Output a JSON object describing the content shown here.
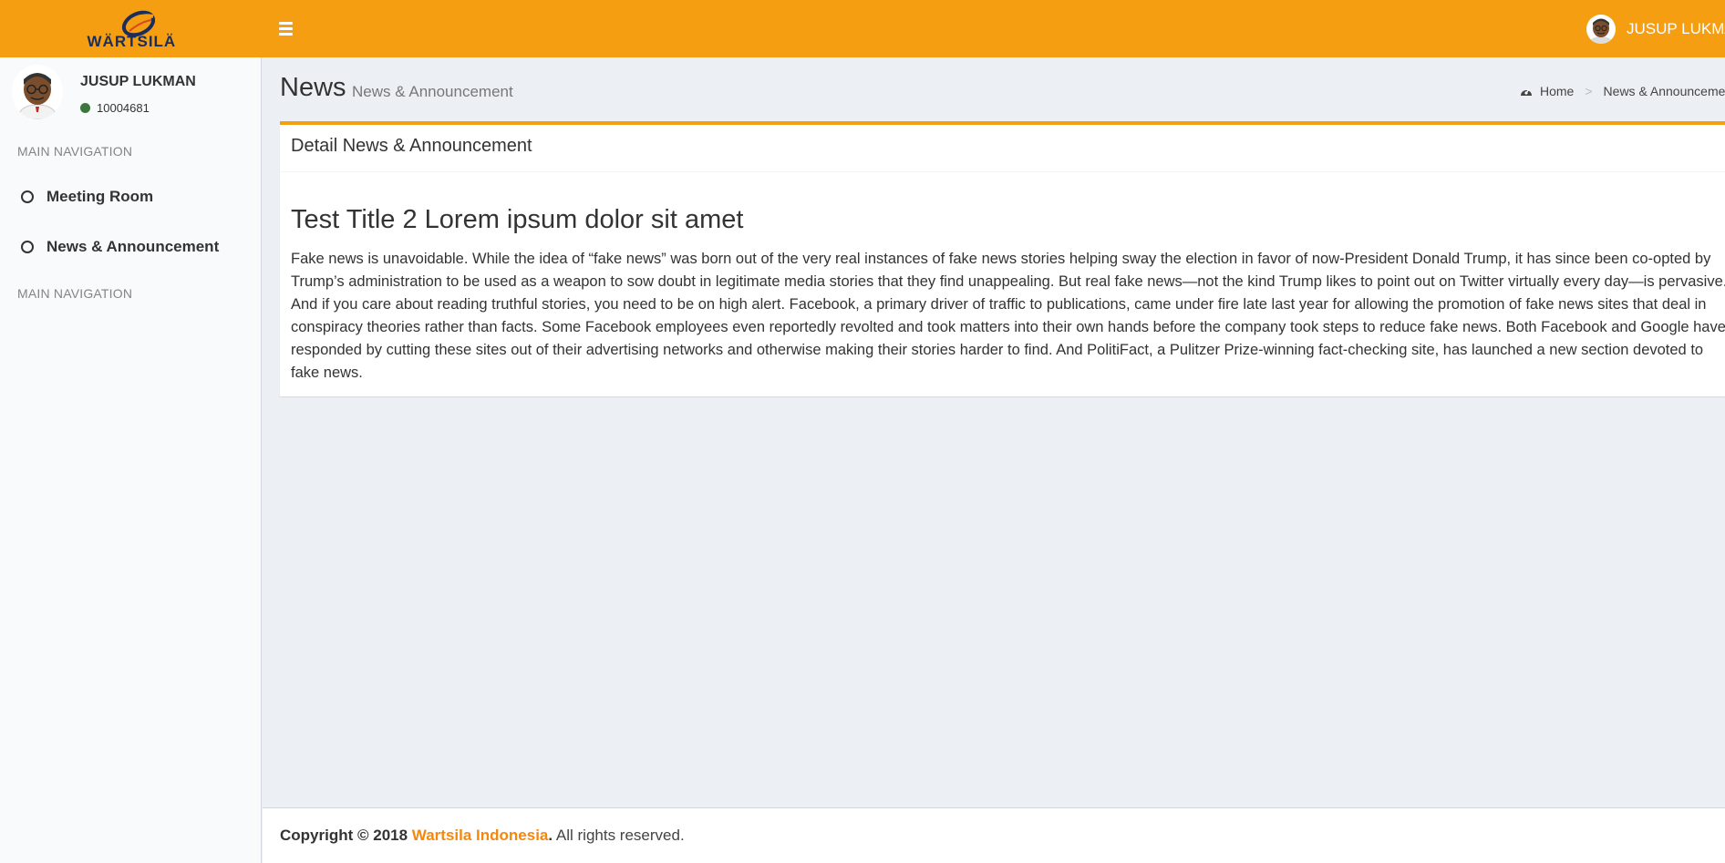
{
  "header": {
    "logo_text": "WÄRTSILÄ",
    "user_name": "JUSUP LUKMAN"
  },
  "sidebar": {
    "user": {
      "name": "JUSUP LUKMAN",
      "id": "10004681"
    },
    "nav_header_1": "MAIN NAVIGATION",
    "items": [
      {
        "label": "Meeting Room"
      },
      {
        "label": "News & Announcement"
      }
    ],
    "nav_header_2": "MAIN NAVIGATION"
  },
  "content_header": {
    "title": "News",
    "subtitle": "News & Announcement",
    "breadcrumb": {
      "home": "Home",
      "separator": ">",
      "current": "News & Announcement"
    }
  },
  "box": {
    "title": "Detail News & Announcement",
    "article_title": "Test Title 2 Lorem ipsum dolor sit amet",
    "article_body": "Fake news is unavoidable. While the idea of “fake news” was born out of the very real instances of fake news stories helping sway the election in favor of now-President Donald Trump, it has since been co-opted by Trump’s administration to be used as a weapon to sow doubt in legitimate media stories that they find unappealing. But real fake news—not the kind Trump likes to point out on Twitter virtually every day—is pervasive. And if you care about reading truthful stories, you need to be on high alert. Facebook, a primary driver of traffic to publications, came under fire late last year for allowing the promotion of fake news sites that deal in conspiracy theories rather than facts. Some Facebook employees even reportedly revolted and took matters into their own hands before the company took steps to reduce fake news. Both Facebook and Google have responded by cutting these sites out of their advertising networks and otherwise making their stories harder to find. And PolitiFact, a Pulitzer Prize-winning fact-checking site, has launched a new section devoted to fake news."
  },
  "footer": {
    "copyright": "Copyright © 2018",
    "company": "Wartsila Indonesia",
    "dot": ".",
    "rights": " All rights reserved."
  },
  "colors": {
    "brand": "#f59e12",
    "status_online": "#3c763d",
    "link": "#f5870d"
  },
  "icons": {
    "menu": "hamburger-menu-icon",
    "home": "dashboard-icon",
    "nav": "circle-outline-icon",
    "status": "online-dot-icon"
  }
}
